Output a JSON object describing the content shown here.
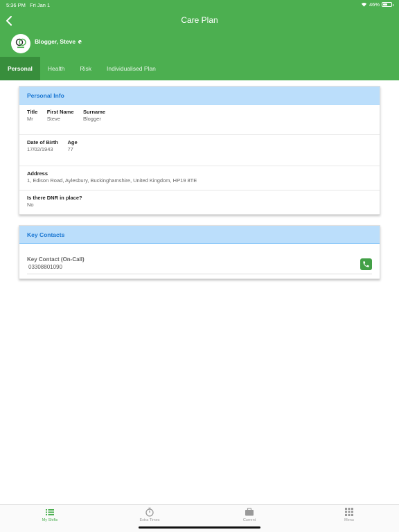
{
  "status_bar": {
    "time": "5:36 PM",
    "date": "Fri Jan 1",
    "battery": "46%"
  },
  "header": {
    "title": "Care Plan",
    "client_name": "Blogger, Steve"
  },
  "tabs": [
    {
      "label": "Personal",
      "active": true
    },
    {
      "label": "Health",
      "active": false
    },
    {
      "label": "Risk",
      "active": false
    },
    {
      "label": "Individualised Plan",
      "active": false
    }
  ],
  "personal_info": {
    "heading": "Personal Info",
    "title_label": "Title",
    "title_value": "Mr",
    "first_name_label": "First Name",
    "first_name_value": "Steve",
    "surname_label": "Surname",
    "surname_value": "Blogger",
    "dob_label": "Date of Birth",
    "dob_value": "17/02/1943",
    "age_label": "Age",
    "age_value": "77",
    "address_label": "Address",
    "address_value": "1, Edison Road, Aylesbury, Buckinghamshire, United Kingdom, HP19 8TE",
    "dnr_label": "Is there DNR in place?",
    "dnr_value": "No"
  },
  "key_contacts": {
    "heading": "Key Contacts",
    "contact_label": "Key Contact (On-Call)",
    "contact_number": "03308801090"
  },
  "tabbar": [
    {
      "label": "My Shifts",
      "icon": "list-icon",
      "active": true
    },
    {
      "label": "Extra Times",
      "icon": "stopwatch-icon",
      "active": false
    },
    {
      "label": "Current",
      "icon": "briefcase-icon",
      "active": false
    },
    {
      "label": "Menu",
      "icon": "grid-icon",
      "active": false
    }
  ],
  "colors": {
    "primary": "#4caf50",
    "tab_active": "#388e3c",
    "card_header": "#bbdefb",
    "heading_text": "#1976d2",
    "call_button": "#43a047"
  }
}
